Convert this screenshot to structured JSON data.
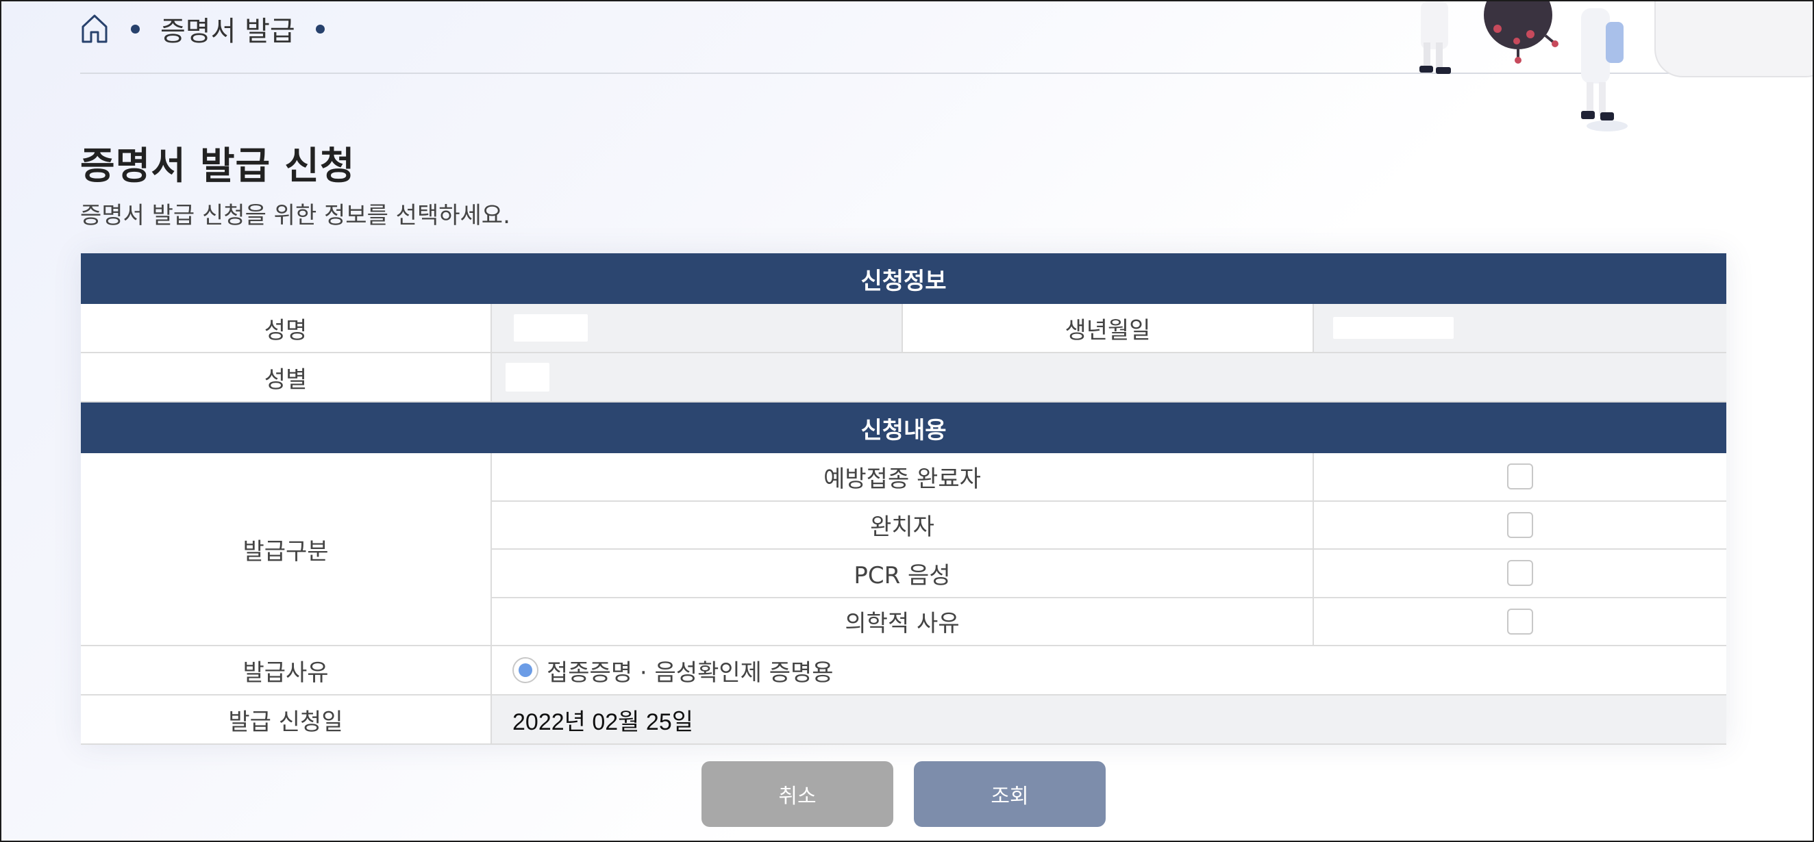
{
  "breadcrumb": {
    "home_icon": "home-icon",
    "current": "증명서 발급"
  },
  "page": {
    "title": "증명서 발급 신청",
    "subtitle": "증명서 발급 신청을 위한 정보를 선택하세요."
  },
  "applicant_section": {
    "header": "신청정보",
    "name_label": "성명",
    "name_value": "",
    "birth_label": "생년월일",
    "birth_value": "",
    "gender_label": "성별",
    "gender_value": ""
  },
  "request_section": {
    "header": "신청내용",
    "type_label": "발급구분",
    "type_options": [
      {
        "label": "예방접종 완료자",
        "checked": false
      },
      {
        "label": "완치자",
        "checked": false
      },
      {
        "label": "PCR 음성",
        "checked": false
      },
      {
        "label": "의학적 사유",
        "checked": false
      }
    ],
    "reason_label": "발급사유",
    "reason_option": "접종증명 · 음성확인제 증명용",
    "reason_selected": true,
    "date_label": "발급 신청일",
    "date_value": "2022년 02월 25일"
  },
  "buttons": {
    "cancel": "취소",
    "search": "조회"
  },
  "colors": {
    "header_bg": "#2c4670",
    "cancel_bg": "#a8a8a8",
    "search_bg": "#7d8dab",
    "radio_accent": "#6b9ce6"
  }
}
